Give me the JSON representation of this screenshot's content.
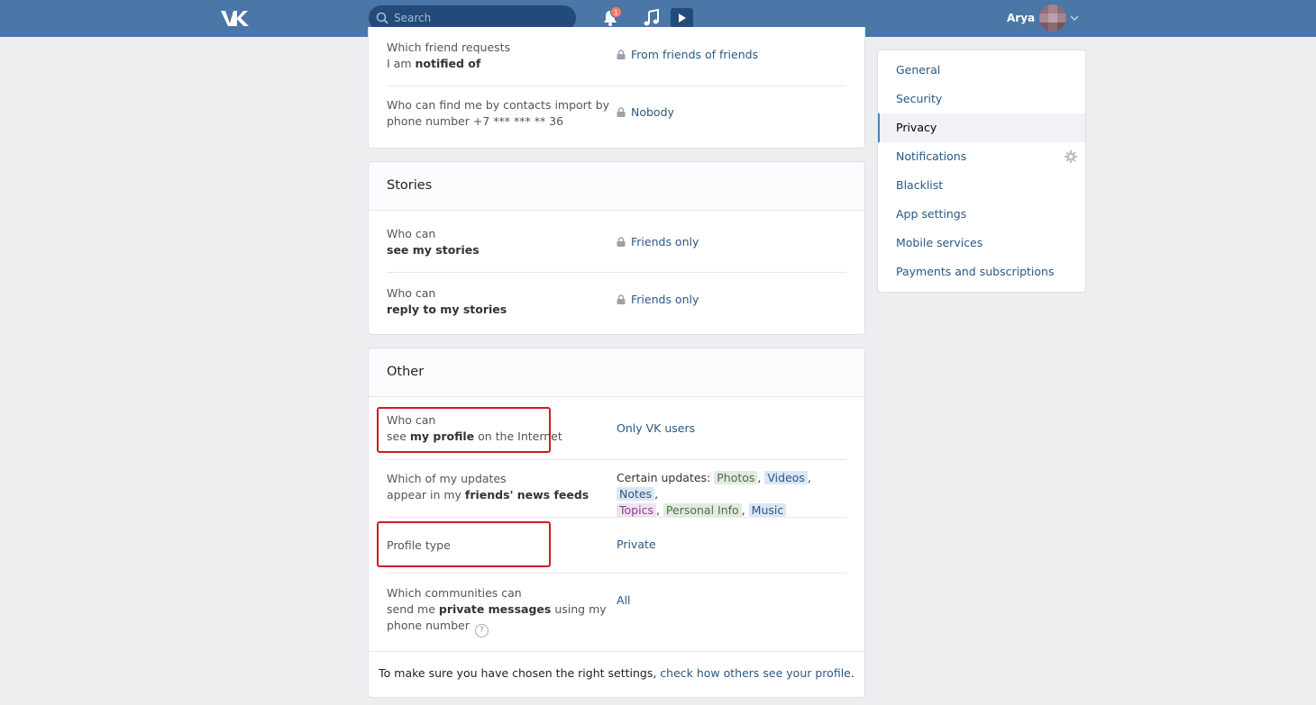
{
  "header": {
    "search_placeholder": "Search",
    "notification_count": "1",
    "user_name": "Arya"
  },
  "privacy_top": {
    "rows": [
      {
        "label_pre": "Which friend requests",
        "label_line2_pre": "I am ",
        "label_bold": "notified of",
        "value": "From friends of friends"
      },
      {
        "label_line1": "Who can find me by contacts import by",
        "label_line2": "phone number +7 *** *** ** 36",
        "value": "Nobody"
      }
    ]
  },
  "stories": {
    "title": "Stories",
    "rows": [
      {
        "label_line1": "Who can",
        "label_bold": "see my stories",
        "value": "Friends only"
      },
      {
        "label_line1": "Who can",
        "label_bold": "reply to my stories",
        "value": "Friends only"
      }
    ]
  },
  "other": {
    "title": "Other",
    "profile_internet": {
      "line1": "Who can",
      "pre": "see ",
      "bold": "my profile",
      "post": " on the Internet",
      "value": "Only VK users"
    },
    "news_feeds": {
      "line1": "Which of my updates",
      "pre": "appear in my ",
      "bold": "friends' news feeds",
      "value_pre": "Certain updates:",
      "tags": [
        "Photos",
        "Videos",
        "Notes",
        "Topics",
        "Personal Info",
        "Music"
      ]
    },
    "profile_type": {
      "label": "Profile type",
      "value": "Private"
    },
    "communities": {
      "line1": "Which communities can",
      "pre": "send me ",
      "bold": "private messages",
      "post": " using my",
      "line3": "phone number",
      "help": "?",
      "value": "All"
    },
    "footer_pre": "To make sure you have chosen the right settings, ",
    "footer_link": "check how others see your profile",
    "footer_post": "."
  },
  "menu": {
    "items": [
      "General",
      "Security",
      "Privacy",
      "Notifications",
      "Blacklist",
      "App settings",
      "Mobile services",
      "Payments and subscriptions"
    ],
    "active": "Privacy"
  },
  "colors": {
    "header": "#4a76a8",
    "link": "#2a5885",
    "highlight": "#cc1c24"
  }
}
